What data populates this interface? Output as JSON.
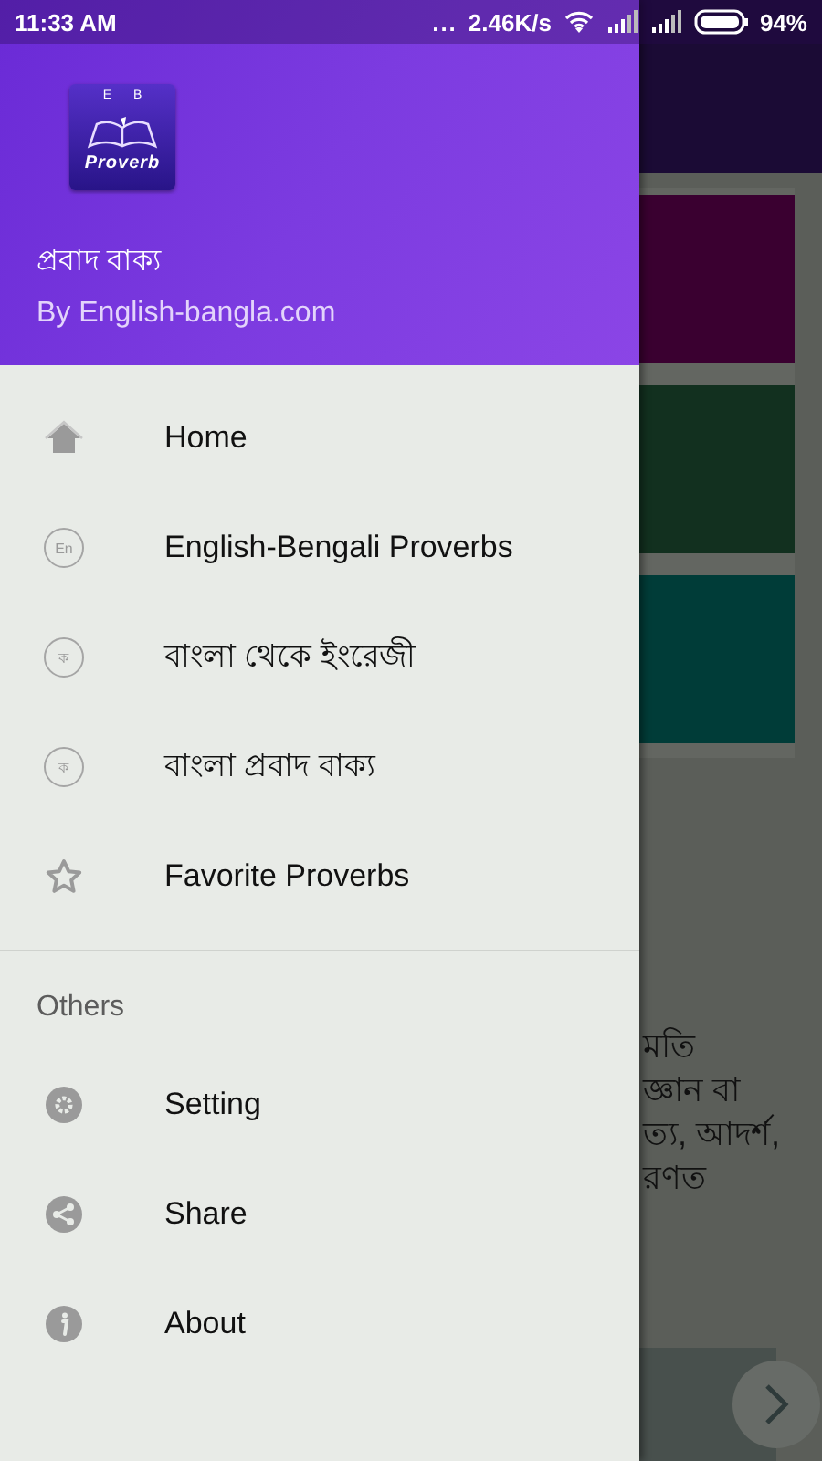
{
  "status_bar": {
    "time": "11:33 AM",
    "dots": "...",
    "speed": "2.46K/s",
    "battery": "94%"
  },
  "drawer": {
    "logo": {
      "letters": [
        "E",
        "B"
      ],
      "word": "Proverb"
    },
    "title": "প্রবাদ বাক্য",
    "subtitle": "By English-bangla.com",
    "items": [
      {
        "kind": "home",
        "label": "Home"
      },
      {
        "kind": "letter",
        "glyph": "En",
        "label": "English-Bengali Proverbs"
      },
      {
        "kind": "letter",
        "glyph": "ক",
        "label": "বাংলা থেকে ইংরেজী"
      },
      {
        "kind": "letter",
        "glyph": "ক",
        "label": "বাংলা প্রবাদ বাক্য"
      },
      {
        "kind": "star",
        "label": "Favorite Proverbs"
      }
    ],
    "section": "Others",
    "others": [
      {
        "kind": "gear",
        "label": "Setting"
      },
      {
        "kind": "share",
        "label": "Share"
      },
      {
        "kind": "info",
        "label": "About"
      }
    ]
  },
  "background": {
    "cards": [
      {
        "color": "#3a0030"
      },
      {
        "color": "#12301f"
      },
      {
        "color": "#003c38"
      }
    ],
    "text_lines": [
      "মতি",
      "জ্ঞান বা",
      "ত্য, আদর্শ,",
      "রণত"
    ]
  }
}
